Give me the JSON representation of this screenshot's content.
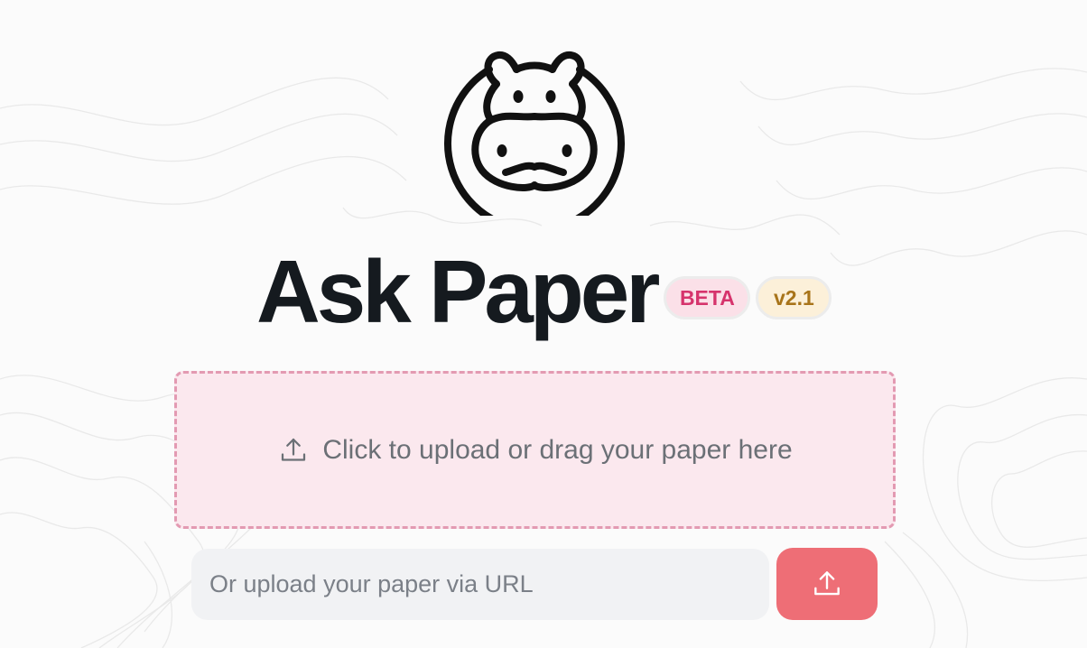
{
  "app": {
    "title": "Ask Paper",
    "badges": {
      "beta": "BETA",
      "version": "v2.1"
    }
  },
  "upload": {
    "dropzone_text": "Click to upload or drag your paper here",
    "url_placeholder": "Or upload your paper via URL",
    "url_value": ""
  },
  "icons": {
    "logo": "hippo-logo-icon",
    "dropzone": "upload-icon",
    "submit": "upload-icon"
  },
  "colors": {
    "title": "#151a1f",
    "beta_badge_bg": "#fbe0e8",
    "beta_badge_text": "#d6336c",
    "version_badge_bg": "#fcf0d9",
    "version_badge_text": "#a8741a",
    "dropzone_bg": "#fbe8ee",
    "dropzone_border": "#e39ab2",
    "input_bg": "#f1f2f4",
    "accent_button": "#ee6e76"
  }
}
